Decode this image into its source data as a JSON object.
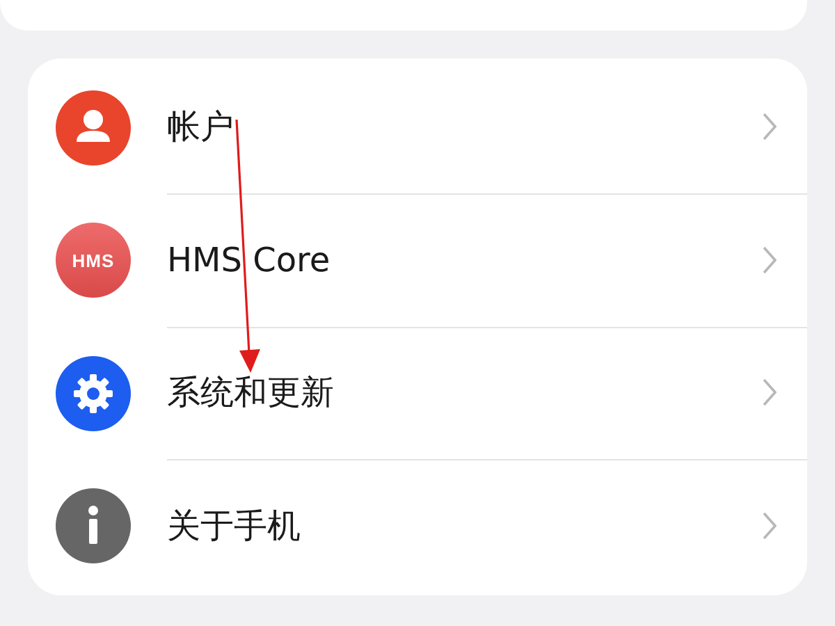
{
  "rows": [
    {
      "kind": "account",
      "label": "帐户"
    },
    {
      "kind": "hms",
      "icon_text": "HMS",
      "label": "HMS Core"
    },
    {
      "kind": "settings",
      "label": "系统和更新"
    },
    {
      "kind": "info",
      "label": "关于手机"
    }
  ]
}
